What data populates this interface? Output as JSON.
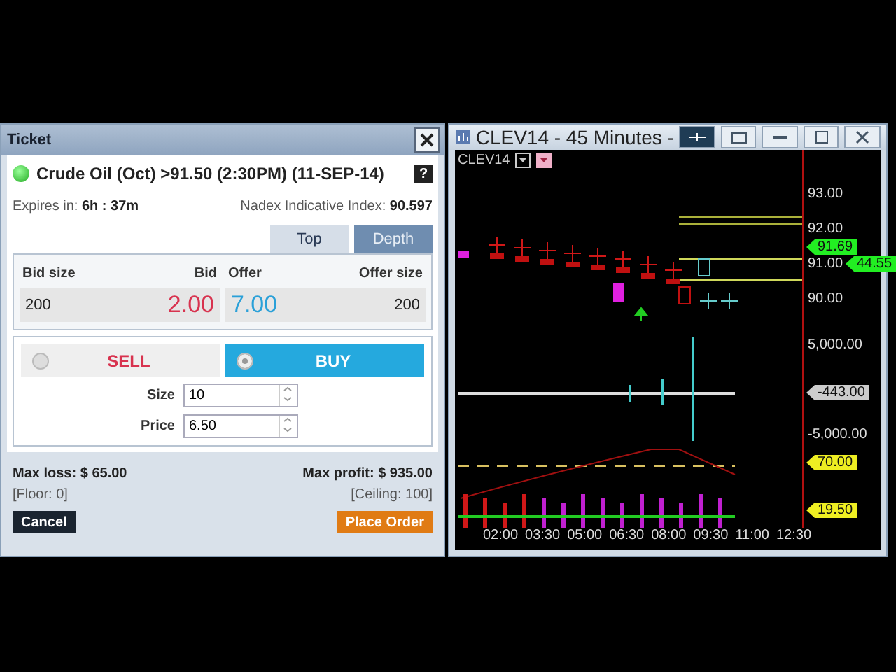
{
  "ticket": {
    "title": "Ticket",
    "instrument": "Crude Oil (Oct) >91.50 (2:30PM) (11-SEP-14)",
    "help": "?",
    "expires_label": "Expires in:",
    "expires_value": "6h : 37m",
    "index_label": "Nadex Indicative Index:",
    "index_value": "90.597",
    "tabs": [
      {
        "label": "Top",
        "selected": true
      },
      {
        "label": "Depth",
        "selected": false
      }
    ],
    "quote": {
      "bid_size_label": "Bid size",
      "bid_label": "Bid",
      "offer_label": "Offer",
      "offer_size_label": "Offer size",
      "bid_size": "200",
      "bid": "2.00",
      "offer": "7.00",
      "offer_size": "200"
    },
    "sides": [
      {
        "label": "SELL",
        "selected": false
      },
      {
        "label": "BUY",
        "selected": true
      }
    ],
    "fields": [
      {
        "label": "Size",
        "value": "10"
      },
      {
        "label": "Price",
        "value": "6.50"
      }
    ],
    "max_loss_label": "Max loss:",
    "max_loss": "$ 65.00",
    "max_profit_label": "Max profit:",
    "max_profit": "$ 935.00",
    "floor": "[Floor: 0]",
    "ceiling": "[Ceiling: 100]",
    "buttons": [
      {
        "label": "Cancel",
        "kind": "secondary"
      },
      {
        "label": "Place Order",
        "kind": "primary"
      }
    ]
  },
  "chart_window": {
    "title": "CLEV14 - 45 Minutes -",
    "symbol": "CLEV14",
    "price_axis": [
      "93.00",
      "92.00",
      "91.00",
      "90.00"
    ],
    "price_tags": [
      {
        "text": "91.69",
        "color": "#22ee22"
      },
      {
        "text": "44.55",
        "color": "#22ee22"
      }
    ],
    "volume_axis": [
      "5,000.00",
      "-5,000.00"
    ],
    "volume_tags": [
      {
        "text": "-443.00",
        "color": "#cccccc"
      }
    ],
    "indicator_tags": [
      {
        "text": "70.00",
        "color": "#eeee22"
      },
      {
        "text": "19.50",
        "color": "#eeee22"
      }
    ],
    "time_axis": [
      "02:00",
      "03:30",
      "05:00",
      "06:30",
      "08:00",
      "09:30",
      "11:00",
      "12:30"
    ]
  }
}
